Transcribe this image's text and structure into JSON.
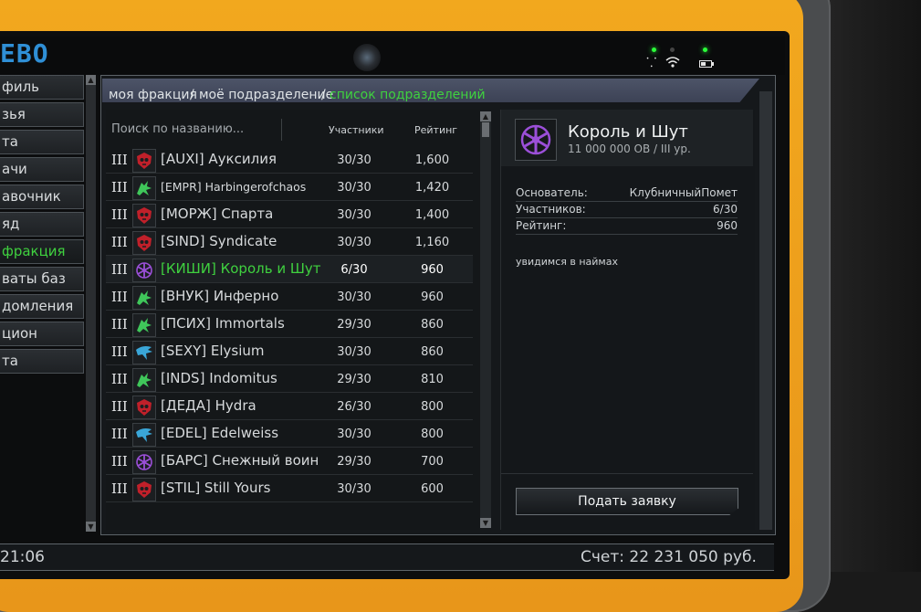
{
  "app": {
    "logo": "ЕВО",
    "clock": "21:06",
    "balance": "Счет: 22 231 050 руб."
  },
  "sidebar": {
    "items": [
      {
        "label": "филь"
      },
      {
        "label": "зья"
      },
      {
        "label": "та"
      },
      {
        "label": "ачи"
      },
      {
        "label": "авочник"
      },
      {
        "label": "яд"
      },
      {
        "label": "фракция",
        "active": true
      },
      {
        "label": "ваты баз"
      },
      {
        "label": "домления"
      },
      {
        "label": "цион"
      },
      {
        "label": "та"
      }
    ]
  },
  "breadcrumb": {
    "part1": "моя фракция",
    "sep1": "/",
    "part2": "моё подразделение",
    "sep2": "/",
    "part3": "список подразделений"
  },
  "list": {
    "search_placeholder": "Поиск по названию...",
    "col_participants": "Участники",
    "col_rating": "Рейтинг",
    "rows": [
      {
        "tier": "III",
        "emblem": "red-skull-icon",
        "name": "[AUXI] Ауксилия",
        "participants": "30/30",
        "rating": "1,600"
      },
      {
        "tier": "III",
        "emblem": "green-dragon-icon",
        "name": "[EMPR] Harbingerofchaos",
        "participants": "30/30",
        "rating": "1,420"
      },
      {
        "tier": "III",
        "emblem": "red-skull-icon",
        "name": "[МОРЖ] Спарта",
        "participants": "30/30",
        "rating": "1,400"
      },
      {
        "tier": "III",
        "emblem": "red-skull-icon",
        "name": "[SIND] Syndicate",
        "participants": "30/30",
        "rating": "1,160"
      },
      {
        "tier": "III",
        "emblem": "purple-rune-icon",
        "name": "[КИШИ] Король и Шут",
        "participants": "6/30",
        "rating": "960",
        "selected": true
      },
      {
        "tier": "III",
        "emblem": "green-dragon-icon",
        "name": "[ВНУК] Инферно",
        "participants": "30/30",
        "rating": "960"
      },
      {
        "tier": "III",
        "emblem": "green-dragon-icon",
        "name": "[ПСИХ] Immortals",
        "participants": "29/30",
        "rating": "860"
      },
      {
        "tier": "III",
        "emblem": "blue-eagle-icon",
        "name": "[SEXY] Elysium",
        "participants": "30/30",
        "rating": "860"
      },
      {
        "tier": "III",
        "emblem": "green-dragon-icon",
        "name": "[INDS] Indomitus",
        "participants": "29/30",
        "rating": "810"
      },
      {
        "tier": "III",
        "emblem": "red-skull-icon",
        "name": "[ДЕДА] Hydra",
        "participants": "26/30",
        "rating": "800"
      },
      {
        "tier": "III",
        "emblem": "blue-eagle-icon",
        "name": "[EDEL] Edelweiss",
        "participants": "30/30",
        "rating": "800"
      },
      {
        "tier": "III",
        "emblem": "purple-rune-icon",
        "name": "[БАРС] Снежный воин",
        "participants": "29/30",
        "rating": "700"
      },
      {
        "tier": "III",
        "emblem": "red-skull-icon",
        "name": "[STIL] Still Yours",
        "participants": "30/30",
        "rating": "600"
      }
    ]
  },
  "detail": {
    "title": "Король и Шут",
    "subtitle": "11 000 000 ОВ / III ур.",
    "founder_label": "Основатель:",
    "founder_value": "КлубничныйПомет",
    "members_label": "Участников:",
    "members_value": "6/30",
    "rating_label": "Рейтинг:",
    "rating_value": "960",
    "description": "увидимся в наймах",
    "apply_label": "Подать заявку"
  },
  "colors": {
    "accent_green": "#3fd13f",
    "frame_yellow": "#f2a81e",
    "logo_blue": "#2f8fd6",
    "emblem_red": "#c0202a",
    "emblem_green": "#3fc65a",
    "emblem_blue": "#3aa6d8",
    "emblem_purple": "#9b4fd8"
  }
}
